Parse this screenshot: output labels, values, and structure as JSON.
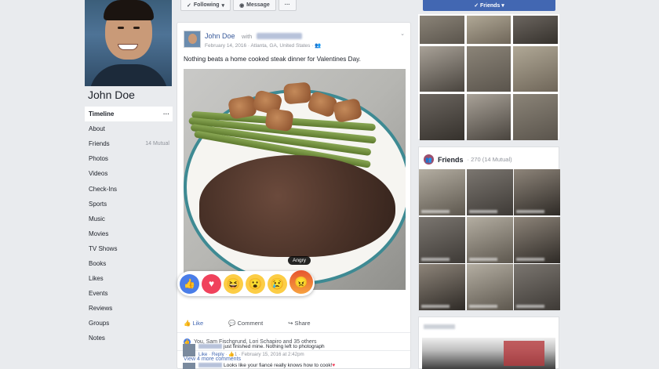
{
  "profile": {
    "name": "John Doe"
  },
  "nav": {
    "items": [
      {
        "label": "Timeline",
        "active": true
      },
      {
        "label": "About"
      },
      {
        "label": "Friends",
        "meta": "14 Mutual"
      },
      {
        "label": "Photos"
      },
      {
        "label": "Videos"
      },
      {
        "label": "Check-Ins"
      },
      {
        "label": "Sports"
      },
      {
        "label": "Music"
      },
      {
        "label": "Movies"
      },
      {
        "label": "TV Shows"
      },
      {
        "label": "Books"
      },
      {
        "label": "Likes"
      },
      {
        "label": "Events"
      },
      {
        "label": "Reviews"
      },
      {
        "label": "Groups"
      },
      {
        "label": "Notes"
      }
    ],
    "more_dots": "···"
  },
  "top_buttons": {
    "following": "Following",
    "message": "Message",
    "more": "···",
    "friends": "Friends"
  },
  "post": {
    "author": "John Doe",
    "with_text": "with",
    "meta": "February 14, 2016 · Atlanta, GA, United States · ",
    "text": "Nothing beats a home cooked steak dinner for Valentines Day.",
    "tooltip": "Angry",
    "actions": {
      "like": "Like",
      "comment": "Comment",
      "share": "Share"
    },
    "likes_summary": "You, Sam Fischgrund, Lori Schapiro and 35 others",
    "more_comments": "View 4 more comments",
    "comments": [
      {
        "text": "just finished mine. Nothing left to photograph",
        "like": "Like",
        "reply": "Reply",
        "count": "1",
        "time": "February 15, 2016 at 2:42pm"
      },
      {
        "text": "Looks like your fiancé really knows how to cook!"
      }
    ]
  },
  "friends_card": {
    "title": "Friends",
    "count": "· 270 (14 Mutual)"
  },
  "colors": {
    "brand_blue": "#4267b2",
    "link_blue": "#365899",
    "background": "#e9ebee",
    "love_red": "#f0425c",
    "angry_orange": "#e6552f"
  },
  "icons": {
    "reactions": [
      "like-icon",
      "love-icon",
      "haha-icon",
      "wow-icon",
      "sad-icon",
      "angry-icon"
    ]
  }
}
